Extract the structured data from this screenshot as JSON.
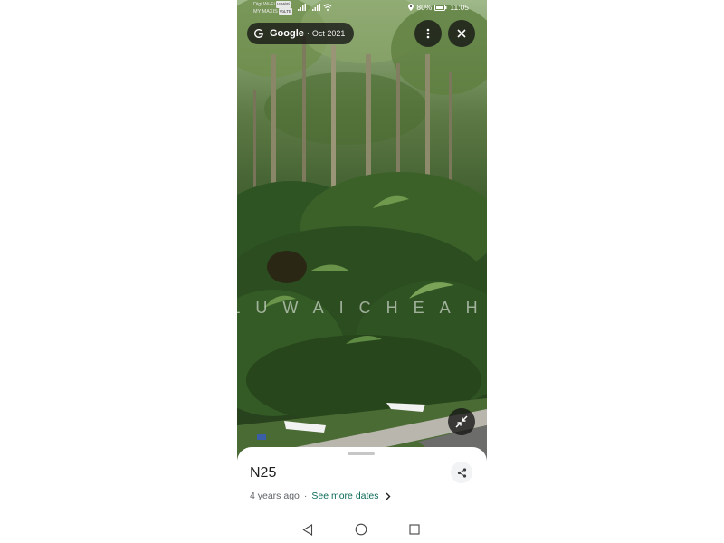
{
  "status_bar": {
    "carrier_line1": "Digi Wi-Fi",
    "carrier_line1_tag": "VoWiFi",
    "carrier_line2": "MY MAXIS",
    "carrier_line2_tag": "VoLTE",
    "battery_percent": "80%",
    "time": "11:05"
  },
  "imagery_chip": {
    "provider": "Google",
    "separator": "·",
    "date": "Oct 2021"
  },
  "place": {
    "title": "N25",
    "age": "4 years ago",
    "separator": "·",
    "see_more_dates": "See more dates"
  },
  "watermark": "LUWAICHEAH",
  "icons": {
    "more": "more-vert-icon",
    "close": "close-icon",
    "collapse": "collapse-arrows-icon",
    "share": "share-icon",
    "chevron": "chevron-right-icon",
    "back": "nav-back-icon",
    "home": "nav-home-icon",
    "recents": "nav-recents-icon"
  },
  "colors": {
    "link": "#0b6a57",
    "chip_bg": "#141414",
    "sheet_bg": "#ffffff"
  }
}
